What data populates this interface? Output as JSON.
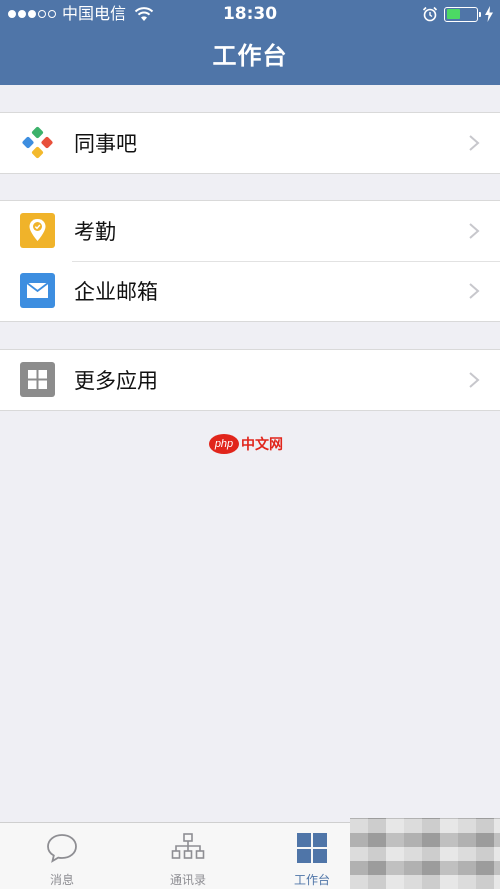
{
  "status_bar": {
    "carrier": "中国电信",
    "time": "18:30",
    "battery_level": 0.45
  },
  "header": {
    "title": "工作台"
  },
  "menu": {
    "groups": [
      {
        "items": [
          {
            "label": "同事吧",
            "icon": "pinwheel-icon"
          }
        ]
      },
      {
        "items": [
          {
            "label": "考勤",
            "icon": "location-check-icon",
            "color": "#f0b32a"
          },
          {
            "label": "企业邮箱",
            "icon": "mail-icon",
            "color": "#3d8ee0"
          }
        ]
      },
      {
        "items": [
          {
            "label": "更多应用",
            "icon": "grid-apps-icon",
            "color": "#8c8c8c"
          }
        ]
      }
    ]
  },
  "watermark": {
    "logo_text": "php",
    "text": "中文网"
  },
  "tabbar": {
    "tabs": [
      {
        "label": "消息",
        "icon": "chat-bubble-icon",
        "active": false
      },
      {
        "label": "通讯录",
        "icon": "org-chart-icon",
        "active": false
      },
      {
        "label": "工作台",
        "icon": "dashboard-grid-icon",
        "active": true
      }
    ]
  },
  "colors": {
    "brand": "#4f75a8",
    "background": "#efeff4",
    "battery": "#4cd964"
  }
}
